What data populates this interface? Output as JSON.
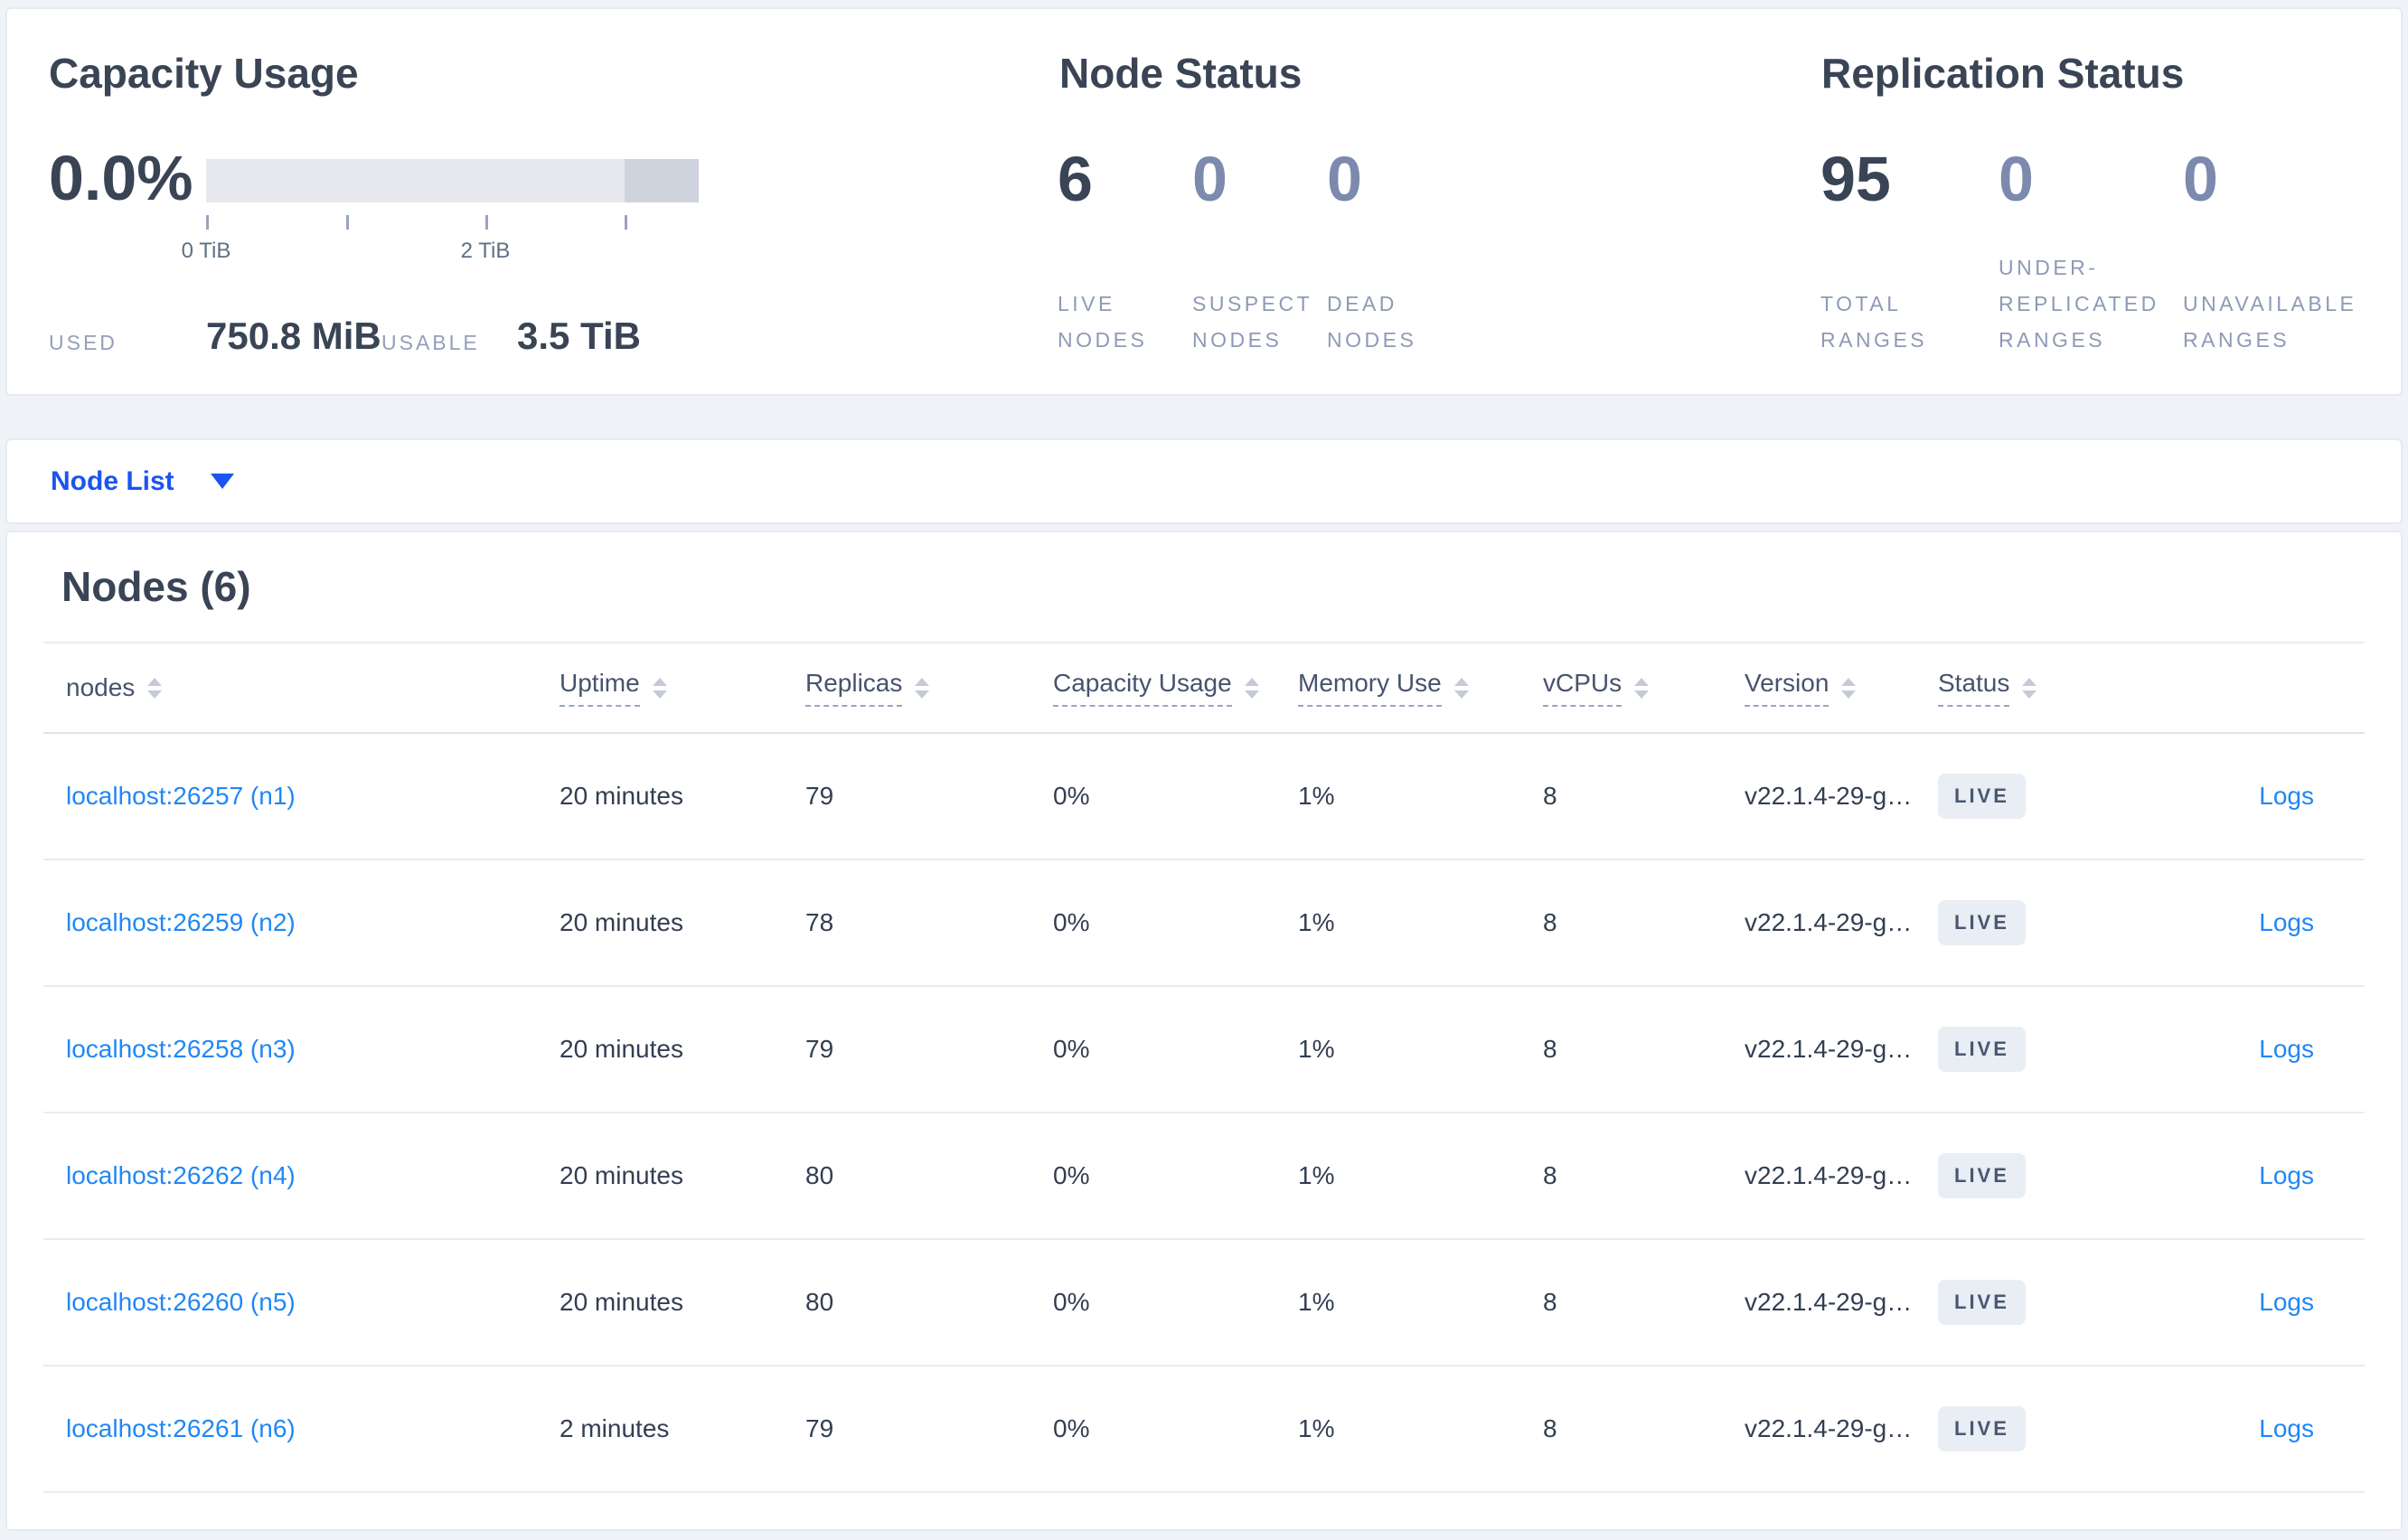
{
  "colors": {
    "accent_link_blue": "#2187f5",
    "nodelist_blue": "#1b54f0",
    "dark_slate": "#394455",
    "muted_blue_gray": "#8d9ab6",
    "badge_bg": "#e9edf4",
    "badge_text": "#475872",
    "gauge_track": "#e6e8ee",
    "gauge_dark_segment": "#ced3de"
  },
  "capacity": {
    "title": "Capacity Usage",
    "percent": "0.0%",
    "tick_label_start": "0 TiB",
    "tick_label_middle": "2 TiB",
    "used_label": "USED",
    "used_value": "750.8 MiB",
    "usable_label": "USABLE",
    "usable_value": "3.5 TiB"
  },
  "node_status": {
    "title": "Node Status",
    "stats": [
      {
        "value": "6",
        "label": "LIVE\nNODES"
      },
      {
        "value": "0",
        "label": "SUSPECT\nNODES"
      },
      {
        "value": "0",
        "label": "DEAD\nNODES"
      }
    ]
  },
  "replication_status": {
    "title": "Replication Status",
    "stats": [
      {
        "value": "95",
        "label": "TOTAL\nRANGES"
      },
      {
        "value": "0",
        "label": "UNDER-\nREPLICATED\nRANGES"
      },
      {
        "value": "0",
        "label": "UNAVAILABLE\nRANGES"
      }
    ]
  },
  "node_list": {
    "label": "Node List"
  },
  "table": {
    "title": "Nodes (6)",
    "columns": [
      {
        "label": "nodes"
      },
      {
        "label": "Uptime"
      },
      {
        "label": "Replicas"
      },
      {
        "label": "Capacity Usage"
      },
      {
        "label": "Memory Use"
      },
      {
        "label": "vCPUs"
      },
      {
        "label": "Version"
      },
      {
        "label": "Status"
      }
    ],
    "logs_label": "Logs",
    "rows": [
      {
        "address": "localhost:26257 (n1)",
        "uptime": "20 minutes",
        "replicas": "79",
        "capacity": "0%",
        "memory": "1%",
        "vcpus": "8",
        "version": "v22.1.4-29-g…",
        "status": "LIVE"
      },
      {
        "address": "localhost:26259 (n2)",
        "uptime": "20 minutes",
        "replicas": "78",
        "capacity": "0%",
        "memory": "1%",
        "vcpus": "8",
        "version": "v22.1.4-29-g…",
        "status": "LIVE"
      },
      {
        "address": "localhost:26258 (n3)",
        "uptime": "20 minutes",
        "replicas": "79",
        "capacity": "0%",
        "memory": "1%",
        "vcpus": "8",
        "version": "v22.1.4-29-g…",
        "status": "LIVE"
      },
      {
        "address": "localhost:26262 (n4)",
        "uptime": "20 minutes",
        "replicas": "80",
        "capacity": "0%",
        "memory": "1%",
        "vcpus": "8",
        "version": "v22.1.4-29-g…",
        "status": "LIVE"
      },
      {
        "address": "localhost:26260 (n5)",
        "uptime": "20 minutes",
        "replicas": "80",
        "capacity": "0%",
        "memory": "1%",
        "vcpus": "8",
        "version": "v22.1.4-29-g…",
        "status": "LIVE"
      },
      {
        "address": "localhost:26261 (n6)",
        "uptime": "2 minutes",
        "replicas": "79",
        "capacity": "0%",
        "memory": "1%",
        "vcpus": "8",
        "version": "v22.1.4-29-g…",
        "status": "LIVE"
      }
    ]
  }
}
